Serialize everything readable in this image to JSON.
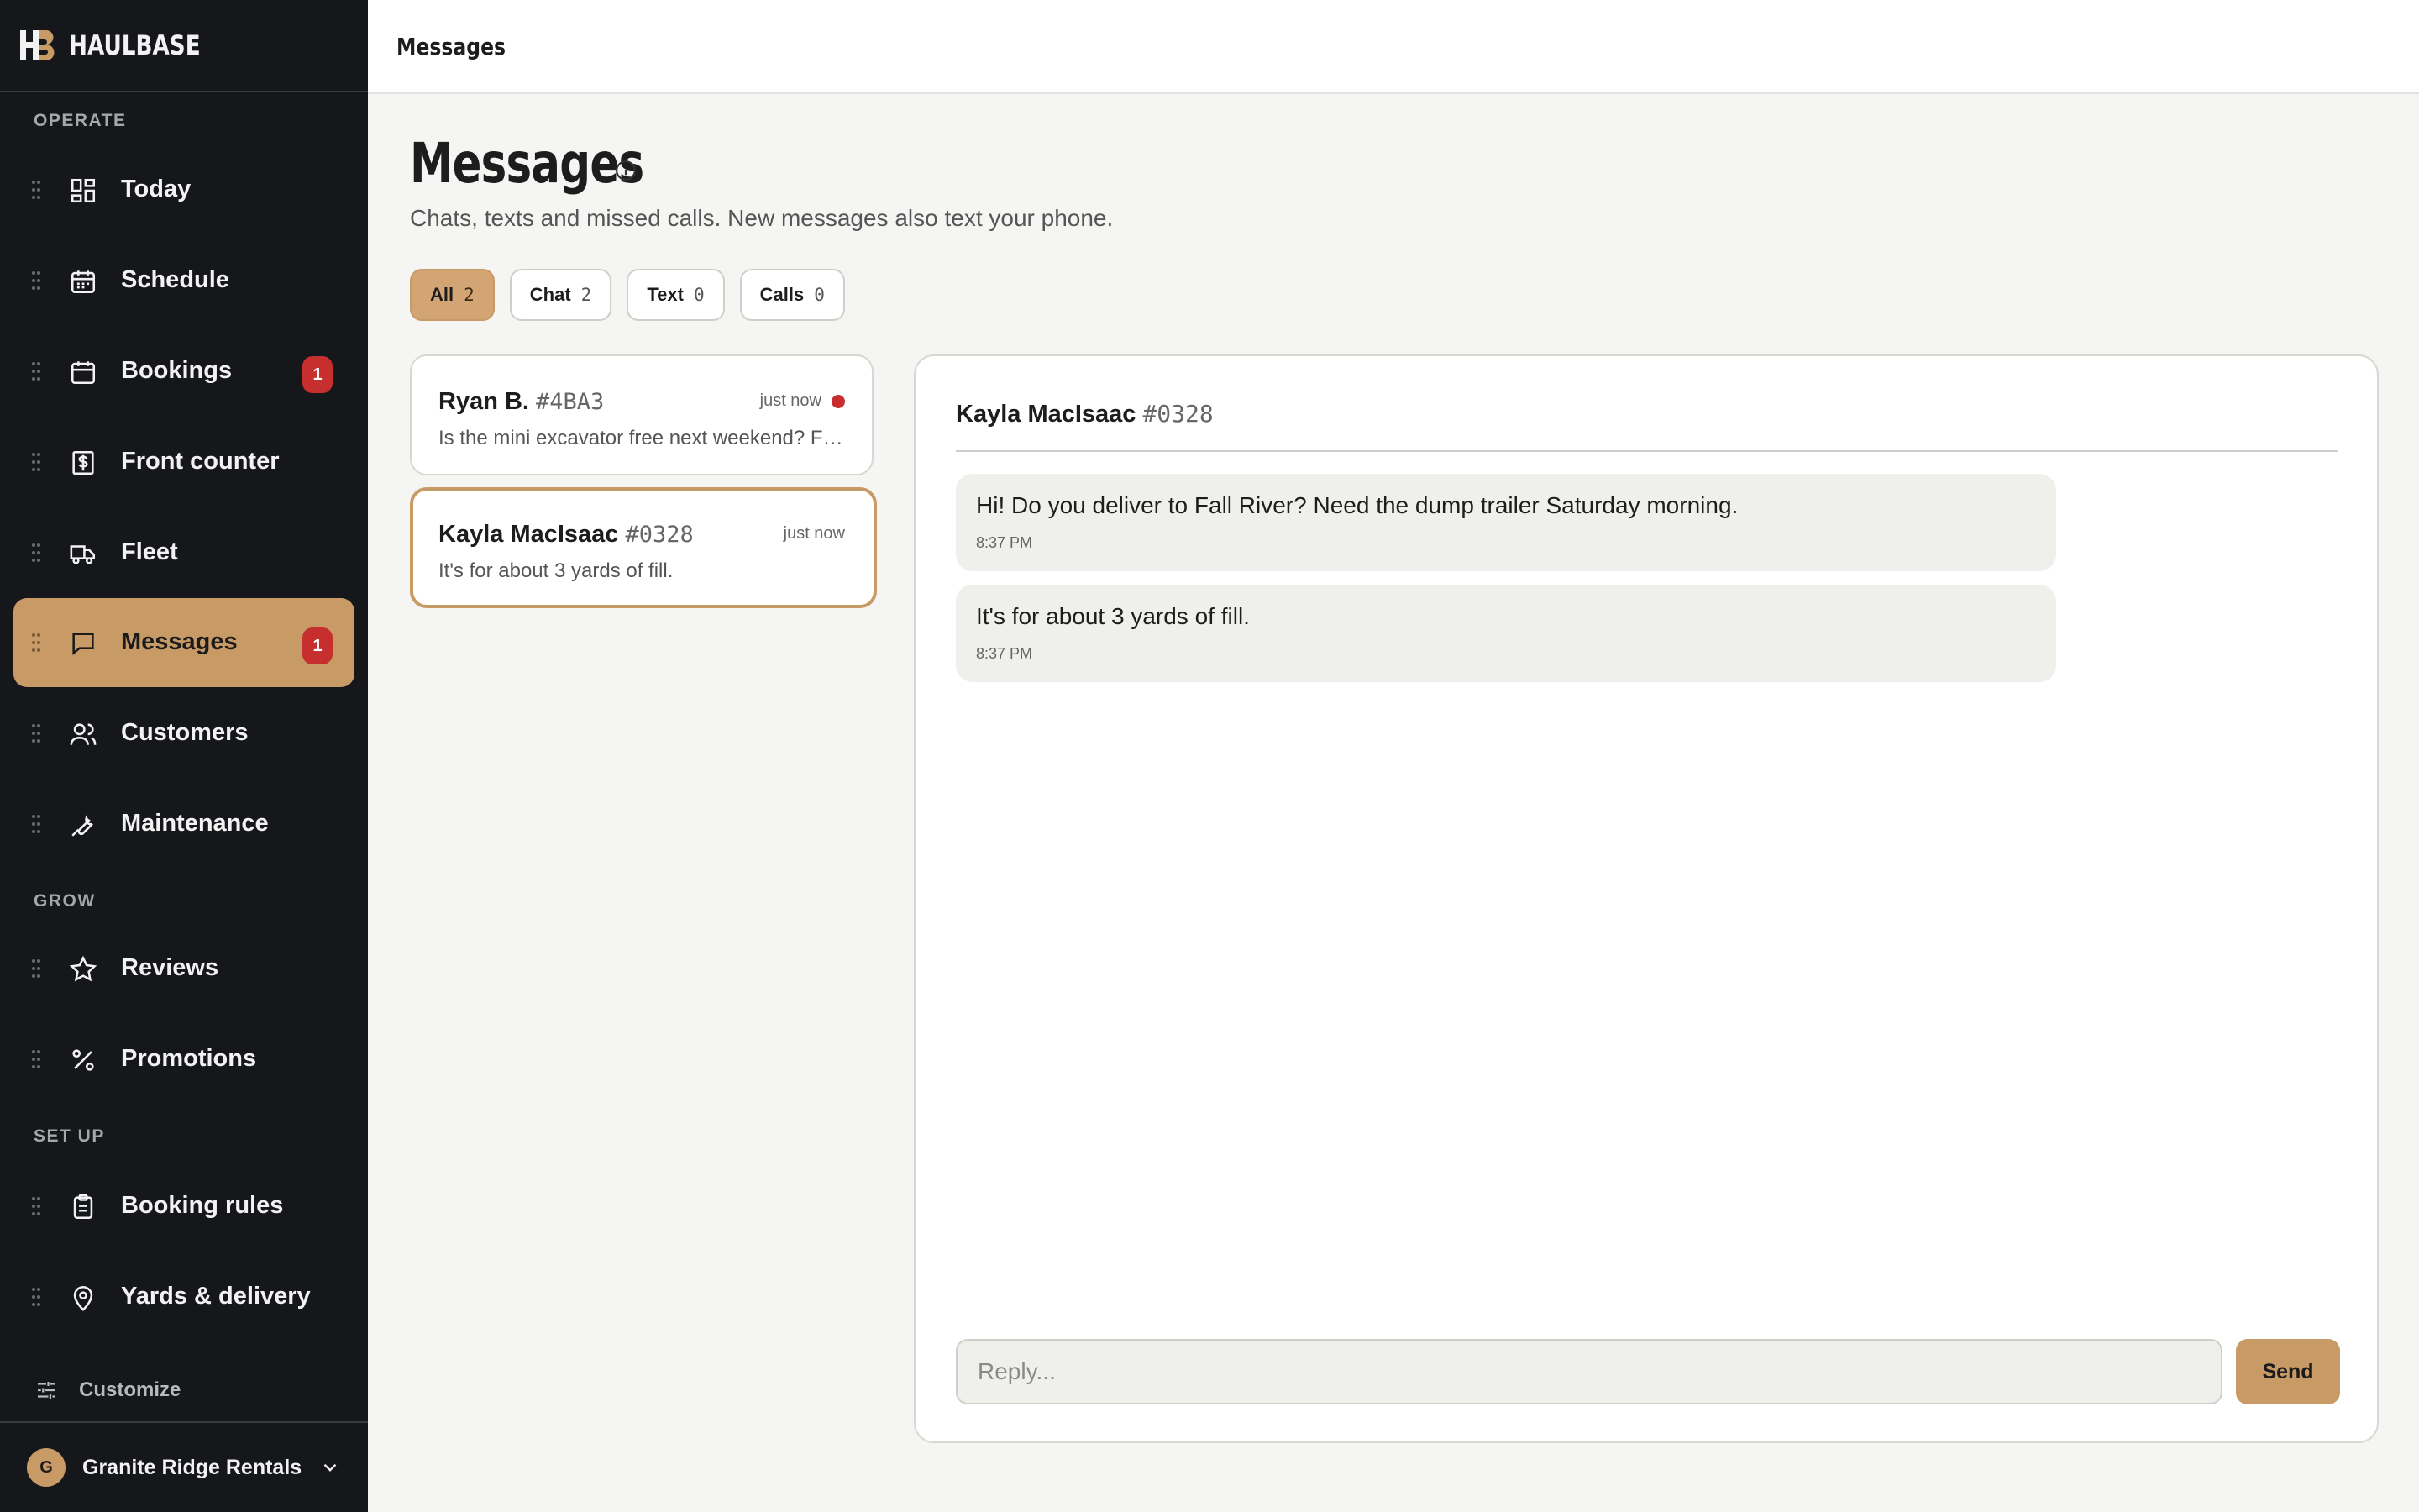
{
  "brand": {
    "name": "HAULBASE",
    "logo_text": "HB"
  },
  "sidebar": {
    "sections": [
      {
        "label": "OPERATE"
      },
      {
        "label": "GROW"
      },
      {
        "label": "SET UP"
      }
    ],
    "items": [
      {
        "label": "Today",
        "icon": "dashboard-icon"
      },
      {
        "label": "Schedule",
        "icon": "calendar-grid-icon"
      },
      {
        "label": "Bookings",
        "icon": "calendar-icon",
        "badge": "1"
      },
      {
        "label": "Front counter",
        "icon": "dollar-receipt-icon"
      },
      {
        "label": "Fleet",
        "icon": "truck-icon"
      },
      {
        "label": "Messages",
        "icon": "chat-icon",
        "badge": "1",
        "active": true
      },
      {
        "label": "Customers",
        "icon": "users-icon"
      },
      {
        "label": "Maintenance",
        "icon": "wrench-icon"
      },
      {
        "label": "Reviews",
        "icon": "star-icon"
      },
      {
        "label": "Promotions",
        "icon": "percent-icon"
      },
      {
        "label": "Booking rules",
        "icon": "clipboard-icon"
      },
      {
        "label": "Yards & delivery",
        "icon": "map-pin-icon"
      }
    ],
    "customize_label": "Customize",
    "org": {
      "avatar": "G",
      "name": "Granite Ridge Rentals"
    }
  },
  "topbar": {
    "title": "Messages"
  },
  "page": {
    "title": "Messages",
    "subtitle": "Chats, texts and missed calls. New messages also text your phone."
  },
  "filters": [
    {
      "label": "All",
      "count": "2",
      "active": true
    },
    {
      "label": "Chat",
      "count": "2"
    },
    {
      "label": "Text",
      "count": "0"
    },
    {
      "label": "Calls",
      "count": "0"
    }
  ],
  "conversations": [
    {
      "name": "Ryan B.",
      "id": "#4BA3",
      "time": "just now",
      "preview": "Is the mini excavator free next weekend? For a small backyard job.",
      "unread": true
    },
    {
      "name": "Kayla MacIsaac",
      "id": "#0328",
      "time": "just now",
      "preview": "It's for about 3 yards of fill.",
      "selected": true
    }
  ],
  "thread": {
    "name": "Kayla MacIsaac",
    "id": "#0328",
    "messages": [
      {
        "text": "Hi! Do you deliver to Fall River? Need the dump trailer Saturday morning.",
        "time": "8:37 PM"
      },
      {
        "text": "It's for about 3 yards of fill.",
        "time": "8:37 PM"
      }
    ],
    "reply_placeholder": "Reply...",
    "send_label": "Send"
  },
  "colors": {
    "accent": "#c89a66",
    "sidebar_bg": "#16171b",
    "badge": "#c72e2e"
  }
}
